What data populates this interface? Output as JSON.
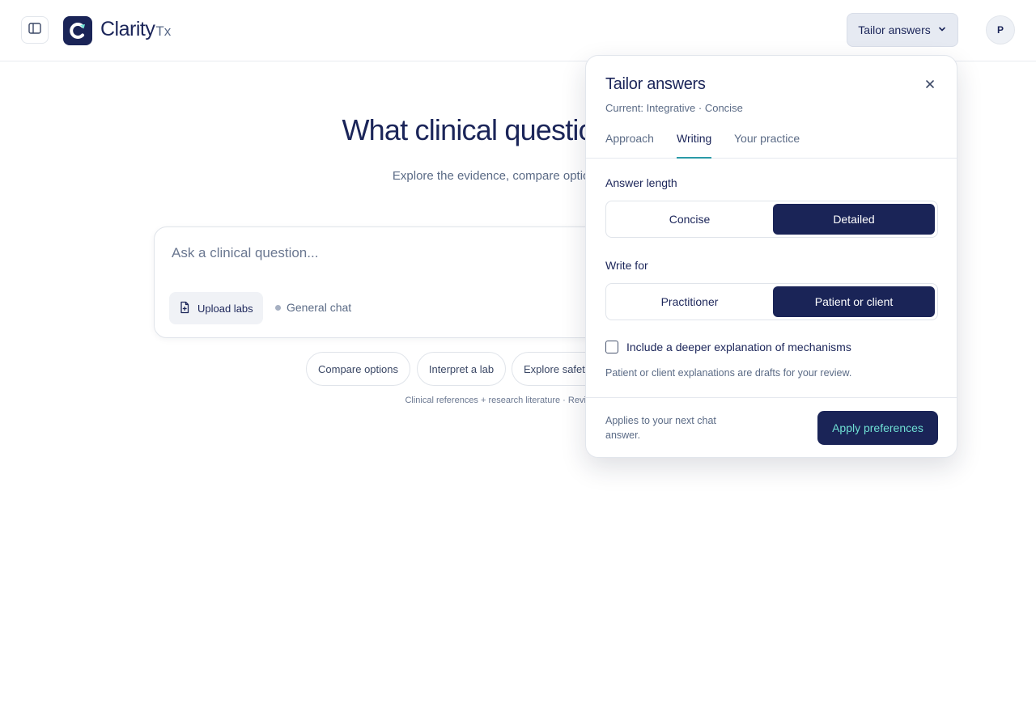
{
  "header": {
    "logo_name": "Clarity",
    "logo_suffix": "Tx",
    "tailor_button_label": "Tailor answers",
    "avatar_initial": "P",
    "icons": {
      "sidebar_toggle": "sidebar-icon",
      "tailor_chevron": "chevron-down-icon",
      "logo": "clarity-logo-icon"
    }
  },
  "main": {
    "title": "What clinical question are yo",
    "subtitle": "Explore the evidence, compare options, or brin",
    "ask_placeholder": "Ask a clinical question...",
    "upload_label": "Upload labs",
    "upload_icon": "file-upload-icon",
    "mode_label": "General chat",
    "suggestions": [
      "Compare options",
      "Interpret a lab",
      "Explore safet"
    ],
    "footnote": "Clinical references + research literature · Review sources"
  },
  "popover": {
    "title": "Tailor answers",
    "current": "Current: Integrative · Concise",
    "close_icon": "close-icon",
    "tabs": [
      {
        "label": "Approach",
        "active": false
      },
      {
        "label": "Writing",
        "active": true
      },
      {
        "label": "Your practice",
        "active": false
      }
    ],
    "answer_length": {
      "label": "Answer length",
      "options": [
        "Concise",
        "Detailed"
      ],
      "selected": "Detailed"
    },
    "write_for": {
      "label": "Write for",
      "options": [
        "Practitioner",
        "Patient or client"
      ],
      "selected": "Patient or client"
    },
    "mechanisms_checkbox": {
      "label": "Include a deeper explanation of mechanisms",
      "checked": false
    },
    "hint": "Patient or client explanations are drafts for your review.",
    "applies_note": "Applies to your next chat answer.",
    "apply_button": "Apply preferences"
  },
  "colors": {
    "navy": "#1a2457",
    "accent_teal": "#2a9aa7",
    "apply_text": "#6fe0d4"
  }
}
